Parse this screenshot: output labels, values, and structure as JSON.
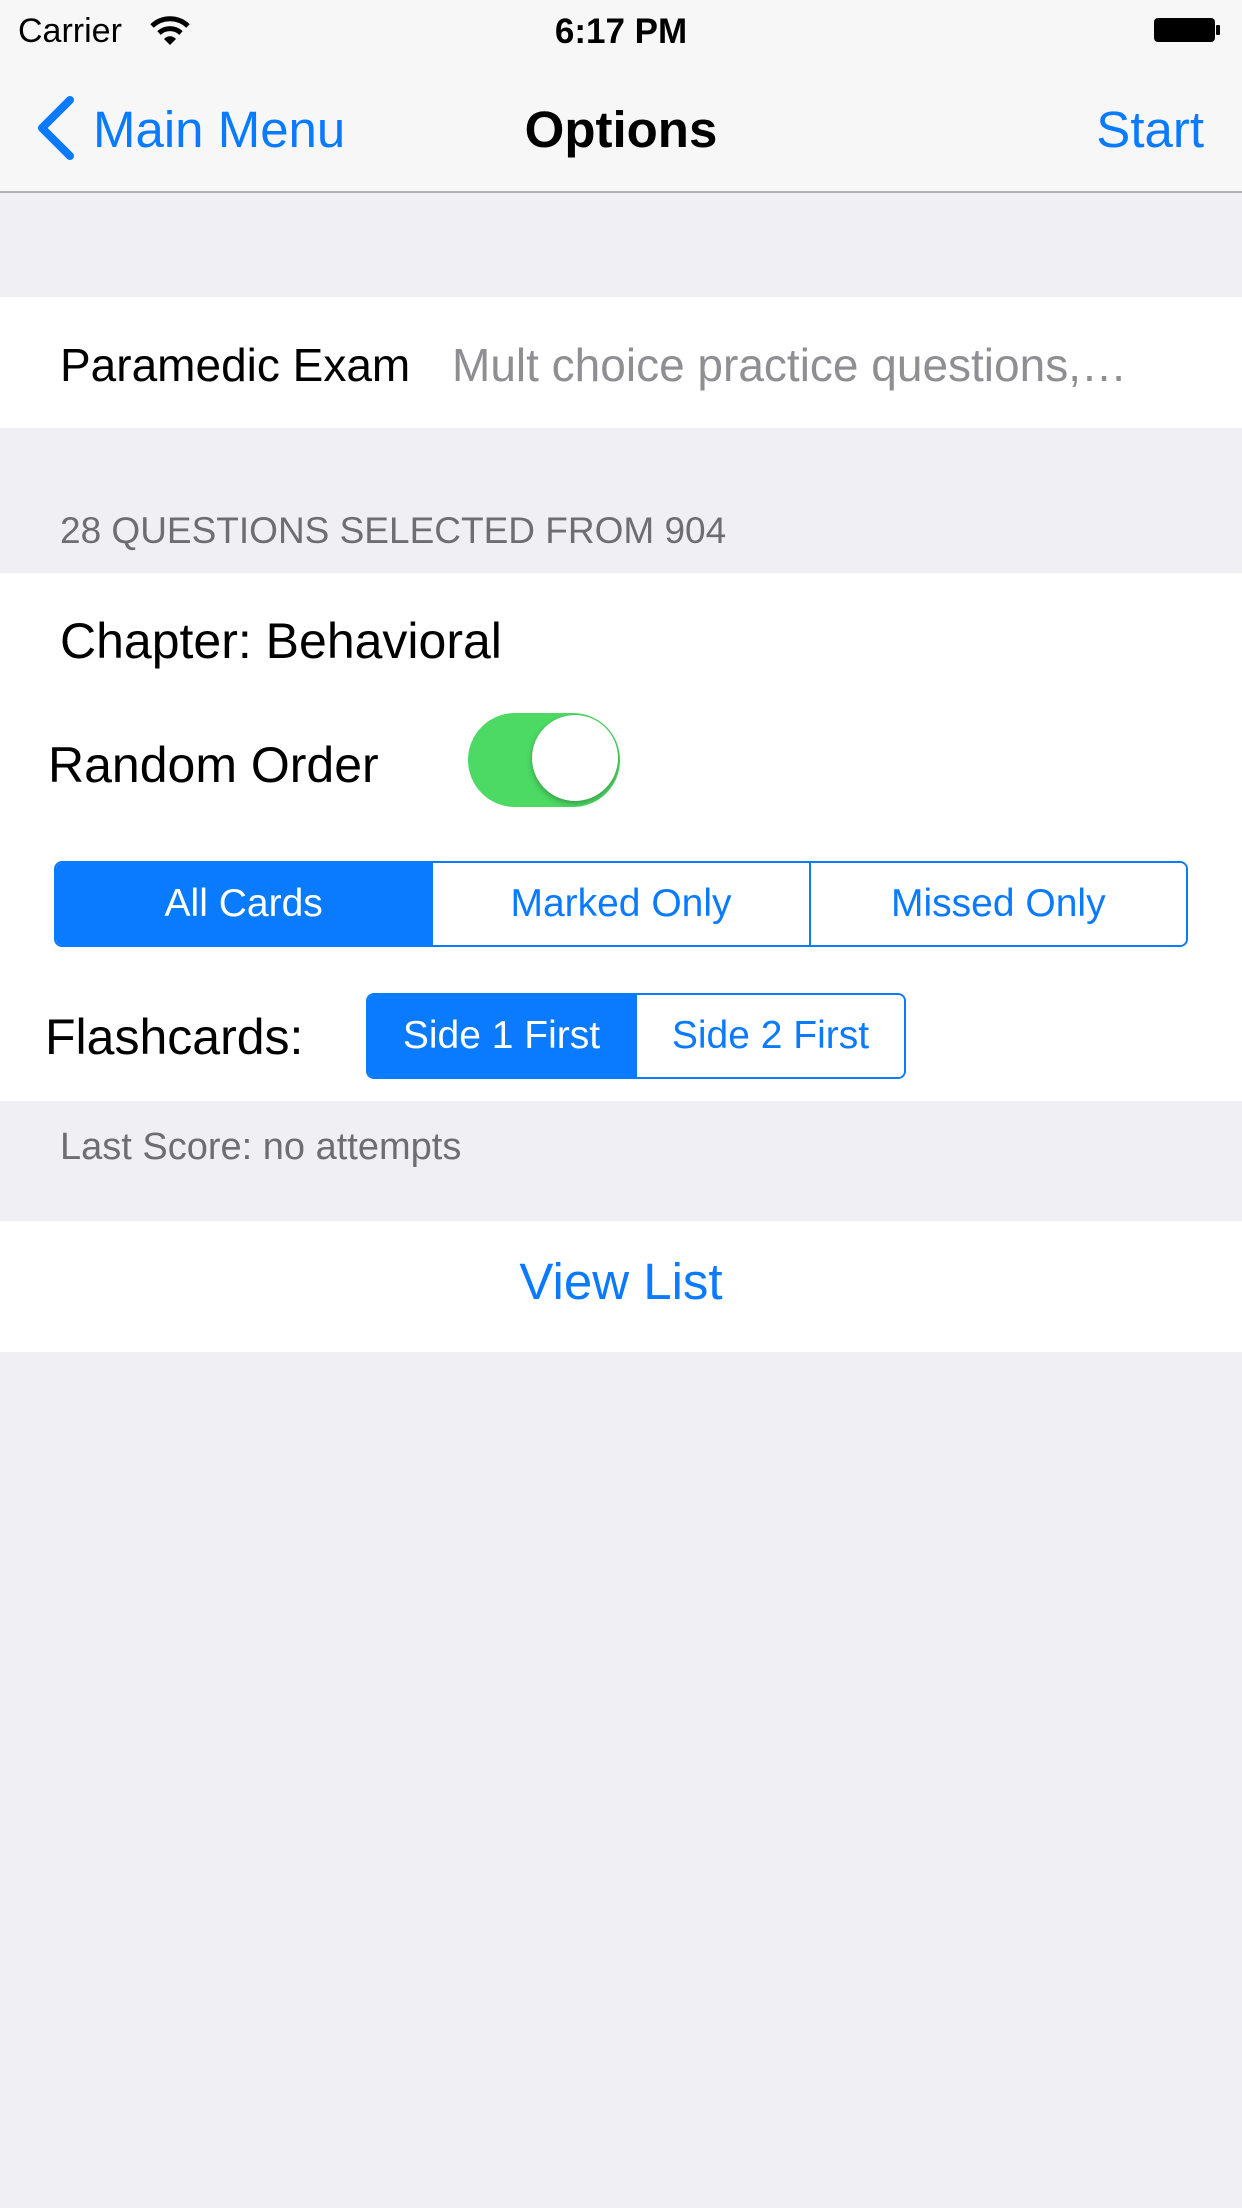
{
  "status_bar": {
    "carrier": "Carrier",
    "time": "6:17 PM",
    "wifi_icon": "wifi-icon",
    "battery_icon": "battery-icon"
  },
  "nav": {
    "back_label": "Main Menu",
    "title": "Options",
    "start_label": "Start"
  },
  "exam": {
    "name": "Paramedic Exam",
    "description": "Mult choice practice questions,…"
  },
  "selection": {
    "header": "28 QUESTIONS SELECTED FROM 904",
    "chapter": "Chapter: Behavioral",
    "random_order_label": "Random Order",
    "random_order_on": true
  },
  "filter_segment": {
    "items": [
      "All Cards",
      "Marked Only",
      "Missed Only"
    ],
    "selected": "All Cards"
  },
  "flashcards": {
    "label": "Flashcards:",
    "items": [
      "Side 1 First",
      "Side 2 First"
    ],
    "selected": "Side 1 First"
  },
  "last_score": "Last Score: no attempts",
  "view_list_label": "View List",
  "colors": {
    "accent": "#0a7aff",
    "toggle_on": "#4cd964",
    "background": "#efeff4"
  }
}
